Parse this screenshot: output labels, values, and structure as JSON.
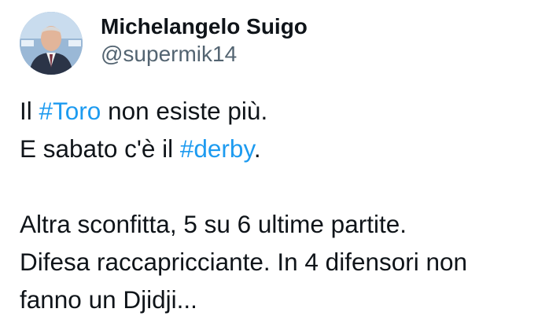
{
  "author": {
    "display_name": "Michelangelo Suigo",
    "handle": "@supermik14"
  },
  "tweet": {
    "line1": {
      "before": "Il ",
      "hashtag": "#Toro",
      "after": " non esiste più."
    },
    "line2": {
      "before": "E sabato c'è il ",
      "hashtag": "#derby",
      "after": "."
    },
    "line3": "Altra sconfitta, 5 su 6 ultime partite.",
    "line4": "Difesa raccapricciante. In 4 difensori non",
    "line5": "fanno un Djidji..."
  },
  "colors": {
    "text": "#0f1419",
    "secondary_text": "#536471",
    "link": "#1d9bf0"
  },
  "icons": {
    "avatar": "profile-photo"
  }
}
